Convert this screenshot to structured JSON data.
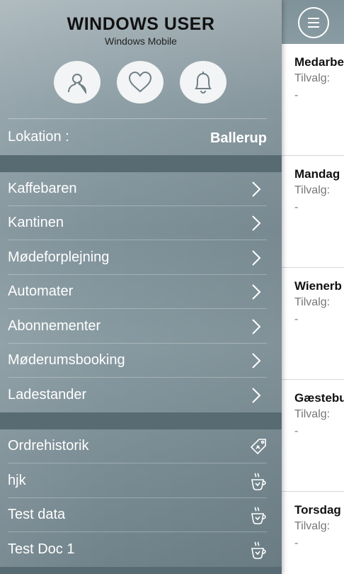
{
  "profile": {
    "name": "WINDOWS USER",
    "subtitle": "Windows Mobile",
    "buttons": [
      {
        "icon": "user-icon"
      },
      {
        "icon": "heart-icon"
      },
      {
        "icon": "bell-icon"
      }
    ]
  },
  "location": {
    "label": "Lokation :",
    "value": "Ballerup"
  },
  "menu": {
    "items": [
      {
        "label": "Kaffebaren",
        "icon": "chevron-right-icon"
      },
      {
        "label": "Kantinen",
        "icon": "chevron-right-icon"
      },
      {
        "label": "Mødeforplejning",
        "icon": "chevron-right-icon"
      },
      {
        "label": "Automater",
        "icon": "chevron-right-icon"
      },
      {
        "label": "Abonnementer",
        "icon": "chevron-right-icon"
      },
      {
        "label": "Møderumsbooking",
        "icon": "chevron-right-icon"
      },
      {
        "label": "Ladestander",
        "icon": "chevron-right-icon"
      }
    ]
  },
  "secondary": {
    "items": [
      {
        "label": "Ordrehistorik",
        "icon": "price-tag-icon"
      },
      {
        "label": "hjk",
        "icon": "coffee-cup-icon"
      },
      {
        "label": "Test data",
        "icon": "coffee-cup-icon"
      },
      {
        "label": "Test Doc 1",
        "icon": "coffee-cup-icon"
      }
    ]
  },
  "content": {
    "cards": [
      {
        "title": "Medarbe",
        "subtitle": "Tilvalg:",
        "value": "-"
      },
      {
        "title": "Mandag",
        "subtitle": "Tilvalg:",
        "value": "-"
      },
      {
        "title": "Wienerb",
        "subtitle": "Tilvalg:",
        "value": "-"
      },
      {
        "title": "Gæstebu",
        "subtitle": "Tilvalg:",
        "value": "-"
      },
      {
        "title": "Torsdag",
        "subtitle": "Tilvalg:",
        "value": "-"
      }
    ]
  },
  "colors": {
    "drawer_band": "#586a72",
    "text_light": "#ffffff"
  }
}
